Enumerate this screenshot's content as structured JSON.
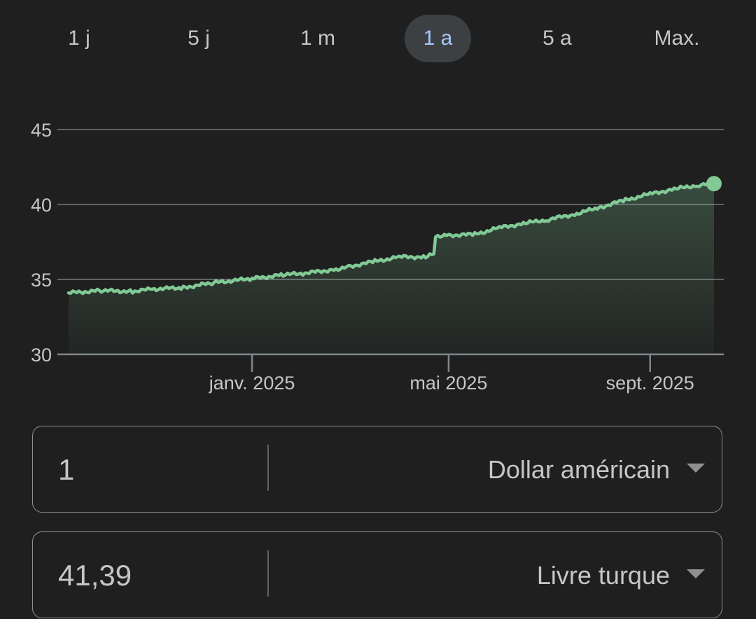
{
  "range_tabs": [
    {
      "label": "1 j",
      "selected": false
    },
    {
      "label": "5 j",
      "selected": false
    },
    {
      "label": "1 m",
      "selected": false
    },
    {
      "label": "1 a",
      "selected": true
    },
    {
      "label": "5 a",
      "selected": false
    },
    {
      "label": "Max.",
      "selected": false
    }
  ],
  "chart_data": {
    "type": "area",
    "x_tick_labels": [
      "janv. 2025",
      "mai 2025",
      "sept. 2025"
    ],
    "y_tick_labels": [
      "30",
      "35",
      "40",
      "45"
    ],
    "ylim": [
      30,
      45
    ],
    "grid": true,
    "series": [
      {
        "points": [
          {
            "x": "2024-09-11",
            "y": 34.1
          },
          {
            "x": "2024-10-01",
            "y": 34.25
          },
          {
            "x": "2024-10-20",
            "y": 34.2
          },
          {
            "x": "2024-11-01",
            "y": 34.35
          },
          {
            "x": "2024-11-20",
            "y": 34.45
          },
          {
            "x": "2024-12-10",
            "y": 34.8
          },
          {
            "x": "2025-01-01",
            "y": 35.05
          },
          {
            "x": "2025-01-20",
            "y": 35.3
          },
          {
            "x": "2025-02-01",
            "y": 35.4
          },
          {
            "x": "2025-02-20",
            "y": 35.65
          },
          {
            "x": "2025-03-01",
            "y": 35.85
          },
          {
            "x": "2025-03-17",
            "y": 36.2
          },
          {
            "x": "2025-04-01",
            "y": 36.5
          },
          {
            "x": "2025-04-17",
            "y": 36.5
          },
          {
            "x": "2025-04-22",
            "y": 36.7
          },
          {
            "x": "2025-04-23",
            "y": 37.9
          },
          {
            "x": "2025-05-01",
            "y": 37.95
          },
          {
            "x": "2025-05-17",
            "y": 38.0
          },
          {
            "x": "2025-06-01",
            "y": 38.45
          },
          {
            "x": "2025-06-17",
            "y": 38.75
          },
          {
            "x": "2025-07-01",
            "y": 39.0
          },
          {
            "x": "2025-07-17",
            "y": 39.35
          },
          {
            "x": "2025-08-01",
            "y": 39.8
          },
          {
            "x": "2025-08-17",
            "y": 40.3
          },
          {
            "x": "2025-09-01",
            "y": 40.7
          },
          {
            "x": "2025-09-17",
            "y": 41.05
          },
          {
            "x": "2025-10-01",
            "y": 41.3
          },
          {
            "x": "2025-10-10",
            "y": 41.39
          }
        ]
      }
    ],
    "colors": {
      "line": "#81c995",
      "grid": "#5f6368"
    }
  },
  "converter": {
    "from": {
      "amount": "1",
      "currency": "Dollar américain"
    },
    "to": {
      "amount": "41,39",
      "currency": "Livre turque"
    }
  }
}
